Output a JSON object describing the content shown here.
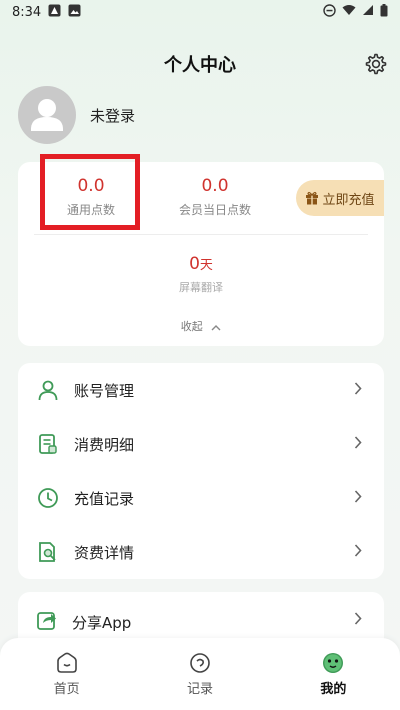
{
  "status_bar": {
    "time": "8:34"
  },
  "header": {
    "title": "个人中心"
  },
  "profile": {
    "username": "未登录"
  },
  "points": {
    "general": {
      "value": "0.0",
      "label": "通用点数"
    },
    "member_today": {
      "value": "0.0",
      "label": "会员当日点数"
    },
    "recharge_label": "立即充值",
    "screen_translate": {
      "value": "0",
      "unit": "天",
      "label": "屏幕翻译"
    },
    "collapse_label": "收起"
  },
  "menu": {
    "items": [
      {
        "label": "账号管理",
        "icon": "user-icon"
      },
      {
        "label": "消费明细",
        "icon": "receipt-icon"
      },
      {
        "label": "充值记录",
        "icon": "clock-icon"
      },
      {
        "label": "资费详情",
        "icon": "document-search-icon"
      }
    ],
    "share_label": "分享App"
  },
  "bottom_nav": {
    "items": [
      {
        "label": "首页",
        "icon": "home-icon"
      },
      {
        "label": "记录",
        "icon": "record-icon"
      },
      {
        "label": "我的",
        "icon": "profile-face-icon"
      }
    ],
    "active_index": 2
  },
  "colors": {
    "accent": "#3f9a57",
    "value_red": "#d0332e",
    "highlight": "#e31e24",
    "recharge_bg": "#f6dfb5"
  }
}
